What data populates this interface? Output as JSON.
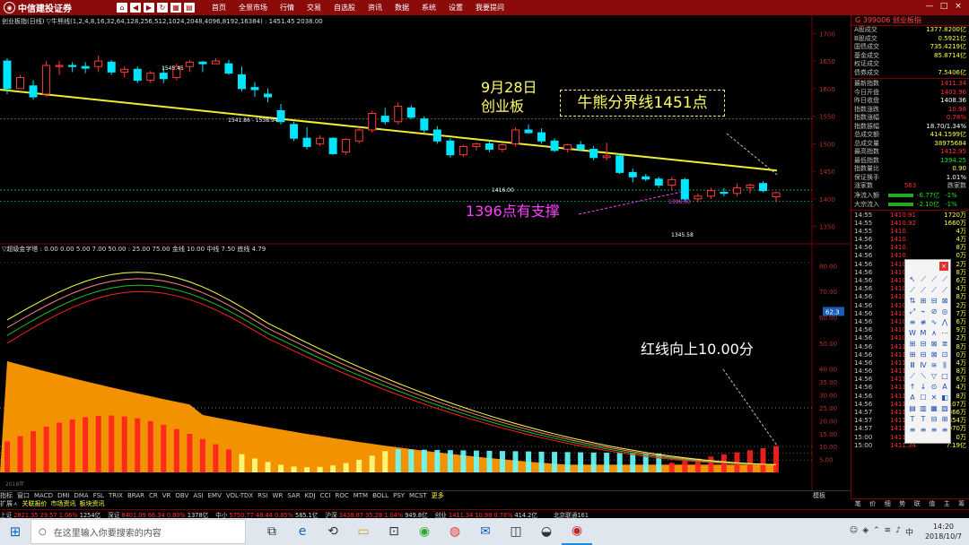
{
  "app": {
    "brand": "中信建投证券",
    "menu": [
      "首页",
      "全景市场",
      "行情",
      "交易",
      "自选股",
      "资讯",
      "数据",
      "系统",
      "设置",
      "我要提问"
    ],
    "window_buttons": [
      "—",
      "□",
      "×"
    ]
  },
  "price_panel": {
    "title": "创业板指(日线)  ▽牛熊线(1,2,4,8,16,32,64,128,256,512,1024,2048,4096,8192,16384)  : 1451.45  2038.00",
    "markers": {
      "high_label": "1545.45",
      "gap_label": "1541.86 - 1538.94",
      "low_label": "1345.58",
      "mid_label": "1416.00",
      "min_label": "1396.00"
    },
    "y_ticks": [
      "1700",
      "1650",
      "1600",
      "1550",
      "1500",
      "1450",
      "1400",
      "1350"
    ]
  },
  "annotations": {
    "date_line1": "9月28日",
    "date_line2": "创业板",
    "bull_bear": "牛熊分界线1451点",
    "support": "1396点有支撑",
    "red_line": "红线向上10.00分"
  },
  "indicator_panel": {
    "title": "▽超级金字塔 : 0.00   0.00   5.00   7.00   50.00 : 25.00   75.00  金线 10.00  中线 7.50  底线 4.79",
    "y_ticks": [
      "80.00",
      "70.00",
      "60.00",
      "50.00",
      "40.00",
      "35.00",
      "30.00",
      "25.00",
      "20.00",
      "15.00",
      "10.00",
      "5.00"
    ],
    "badge": "62.3"
  },
  "right_panel": {
    "code": "G   399006  创业板指",
    "block1": [
      {
        "label": "A股成交",
        "value": "1377.8200亿",
        "color": "#ffff40"
      },
      {
        "label": "B股成交",
        "value": "0.5921亿",
        "color": "#ffff40"
      },
      {
        "label": "国债成交",
        "value": "735.4219亿",
        "color": "#ffff40"
      },
      {
        "label": "基金成交",
        "value": "85.8714亿",
        "color": "#ffff40"
      },
      {
        "label": "权证成交",
        "value": "",
        "color": "#ffff40"
      },
      {
        "label": "债券成交",
        "value": "7.5406亿",
        "color": "#ffff40"
      }
    ],
    "block2": [
      {
        "label": "最新指数",
        "value": "1411.34",
        "color": "#ff3030"
      },
      {
        "label": "今日开盘",
        "value": "1403.96",
        "color": "#ff3030"
      },
      {
        "label": "昨日收盘",
        "value": "1408.36",
        "color": "#ffffff"
      },
      {
        "label": "指数涨跌",
        "value": "10.98",
        "color": "#ff3030"
      },
      {
        "label": "指数涨幅",
        "value": "0.78%",
        "color": "#ff3030"
      },
      {
        "label": "指数振幅",
        "value": "18.70/1.34%",
        "color": "#ffffff"
      },
      {
        "label": "总成交额",
        "value": "414.1599亿",
        "color": "#ffff40"
      },
      {
        "label": "总成交量",
        "value": "38975684",
        "color": "#ffff40"
      },
      {
        "label": "最高指数",
        "value": "1412.95",
        "color": "#ff3030"
      },
      {
        "label": "最低指数",
        "value": "1394.25",
        "color": "#22dd22"
      },
      {
        "label": "指数量比",
        "value": "0.90",
        "color": "#ffff40"
      },
      {
        "label": "保证换手",
        "value": "1.01%",
        "color": "#ffffff"
      }
    ],
    "advance": {
      "label": "涨家数",
      "up": "563",
      "down_label": "跌家数"
    },
    "net_in": [
      {
        "label": "净流入额",
        "value": "-6.77亿",
        "pct": "-1%"
      },
      {
        "label": "大宗流入",
        "value": "-2.10亿",
        "pct": "-1%"
      }
    ],
    "ticks": [
      {
        "t": "14:55",
        "p": "1410.91",
        "v": "1720万"
      },
      {
        "t": "14:55",
        "p": "1410.92",
        "v": "1660万"
      },
      {
        "t": "14:55",
        "p": "1410.",
        "v": "4万"
      },
      {
        "t": "14:56",
        "p": "1410.",
        "v": "4万"
      },
      {
        "t": "14:56",
        "p": "1410.",
        "v": "8万"
      },
      {
        "t": "14:56",
        "p": "1410.",
        "v": "0万"
      },
      {
        "t": "14:56",
        "p": "1410.",
        "v": "2万"
      },
      {
        "t": "14:56",
        "p": "1410.",
        "v": "8万"
      },
      {
        "t": "14:56",
        "p": "1410.",
        "v": "6万"
      },
      {
        "t": "14:56",
        "p": "1410.",
        "v": "4万"
      },
      {
        "t": "14:56",
        "p": "1410.",
        "v": "8万"
      },
      {
        "t": "14:56",
        "p": "1410.",
        "v": "2万"
      },
      {
        "t": "14:56",
        "p": "1410.",
        "v": "7万"
      },
      {
        "t": "14:56",
        "p": "1410.",
        "v": "6万"
      },
      {
        "t": "14:56",
        "p": "1410.",
        "v": "9万"
      },
      {
        "t": "14:56",
        "p": "1410.",
        "v": "2万"
      },
      {
        "t": "14:56",
        "p": "1411.",
        "v": "8万"
      },
      {
        "t": "14:56",
        "p": "1411.",
        "v": "0万"
      },
      {
        "t": "14:56",
        "p": "1411.",
        "v": "4万"
      },
      {
        "t": "14:56",
        "p": "1411.",
        "v": "8万"
      },
      {
        "t": "14:56",
        "p": "1411.",
        "v": "6万"
      },
      {
        "t": "14:56",
        "p": "1411.",
        "v": "4万"
      },
      {
        "t": "14:56",
        "p": "1411.",
        "v": "8万"
      },
      {
        "t": "14:56",
        "p": "1411.82",
        "v": "2107万"
      },
      {
        "t": "14:57",
        "p": "1411.80",
        "v": "1866万"
      },
      {
        "t": "14:57",
        "p": "1411.83",
        "v": "1854万"
      },
      {
        "t": "14:57",
        "p": "1411.83",
        "v": "1970万"
      },
      {
        "t": "15:00",
        "p": "1411.34",
        "v": "0万"
      },
      {
        "t": "15:00",
        "p": "1411.34",
        "v": "7.19亿"
      }
    ],
    "tabs": [
      "笔",
      "价",
      "细",
      "势",
      "联",
      "值",
      "主",
      "筹"
    ]
  },
  "bottom_tabs": [
    "指标",
    "窗口",
    "MACD",
    "DMI",
    "DMA",
    "FSL",
    "TRIX",
    "BRAR",
    "CR",
    "VR",
    "OBV",
    "ASI",
    "EMV",
    "VOL-TDX",
    "RSI",
    "WR",
    "SAR",
    "KDJ",
    "CCI",
    "ROC",
    "MTM",
    "BOLL",
    "PSY",
    "MCST",
    "更多"
  ],
  "bottom_tab_tail": "模板",
  "sub_strip": {
    "label": "扩展ㅅ",
    "items": [
      "关联报价",
      "市场资讯",
      "板块资讯"
    ]
  },
  "index_strip": [
    {
      "name": "上证",
      "price": "2821.35",
      "chg": "29.57",
      "pct": "1.06%",
      "amt": "1254亿"
    },
    {
      "name": "深证",
      "price": "8401.09",
      "chg": "66.34",
      "pct": "0.80%",
      "amt": "1378亿"
    },
    {
      "name": "中小",
      "price": "5750.77",
      "chg": "48.44",
      "pct": "0.85%",
      "amt": "585.1亿"
    },
    {
      "name": "沪深",
      "price": "3438.87",
      "chg": "35.28",
      "pct": "1.04%",
      "amt": "949.8亿"
    },
    {
      "name": "创业",
      "price": "1411.34",
      "chg": "10.98",
      "pct": "0.78%",
      "amt": "414.2亿"
    }
  ],
  "index_strip_tail": "北京联通161",
  "taskbar": {
    "search_placeholder": "在这里输入你要搜索的内容",
    "time": "14:20",
    "date": "2018/10/7"
  },
  "draw_tools": [
    "↖",
    "⟋",
    "⟋",
    "⟋",
    "⟋",
    "⟋",
    "⟋",
    "⟋",
    "⇅",
    "⊞",
    "⊟",
    "⊠",
    "⤢",
    "⌁",
    "⊘",
    "◎",
    "≡",
    "≢",
    "∿",
    "⋀",
    "W",
    "M",
    "∧",
    "⋯",
    "⊞",
    "⊟",
    "⊠",
    "≣",
    "⊞",
    "⊟",
    "⊠",
    "⊡",
    "Ⅲ",
    "Ⅳ",
    "≋",
    "⫼",
    "⟋",
    "⟍",
    "▽",
    "□",
    "↑",
    "↓",
    "⊙",
    "A",
    "A",
    "☐",
    "✕",
    "◧",
    "▤",
    "▥",
    "▦",
    "▧",
    "T",
    "T",
    "⊟",
    "⊞",
    "≡",
    "≡",
    "≡",
    "≡"
  ],
  "chart_data": {
    "type": "candlestick",
    "ylim": [
      1330,
      1720
    ],
    "bull_bear_line": [
      1590,
      1451.45
    ],
    "candles": [
      [
        1650,
        1655,
        1590,
        1600
      ],
      [
        1600,
        1625,
        1600,
        1620
      ],
      [
        1605,
        1615,
        1580,
        1585
      ],
      [
        1590,
        1650,
        1585,
        1642
      ],
      [
        1640,
        1650,
        1625,
        1642
      ],
      [
        1642,
        1648,
        1630,
        1640
      ],
      [
        1640,
        1648,
        1628,
        1637
      ],
      [
        1640,
        1660,
        1630,
        1650
      ],
      [
        1648,
        1652,
        1625,
        1630
      ],
      [
        1630,
        1640,
        1620,
        1635
      ],
      [
        1635,
        1640,
        1610,
        1615
      ],
      [
        1615,
        1632,
        1610,
        1628
      ],
      [
        1628,
        1640,
        1610,
        1618
      ],
      [
        1620,
        1645,
        1615,
        1640
      ],
      [
        1640,
        1652,
        1630,
        1648
      ],
      [
        1648,
        1650,
        1630,
        1645
      ],
      [
        1645,
        1655,
        1645,
        1650
      ],
      [
        1645,
        1652,
        1625,
        1628
      ],
      [
        1625,
        1640,
        1595,
        1600
      ],
      [
        1602,
        1612,
        1585,
        1598
      ],
      [
        1590,
        1600,
        1575,
        1585
      ],
      [
        1560,
        1572,
        1535,
        1540
      ],
      [
        1535,
        1540,
        1505,
        1510
      ],
      [
        1510,
        1530,
        1490,
        1495
      ],
      [
        1500,
        1515,
        1496,
        1510
      ],
      [
        1510,
        1512,
        1480,
        1482
      ],
      [
        1485,
        1510,
        1480,
        1508
      ],
      [
        1505,
        1530,
        1500,
        1525
      ],
      [
        1525,
        1560,
        1520,
        1555
      ],
      [
        1550,
        1565,
        1535,
        1540
      ],
      [
        1540,
        1575,
        1535,
        1568
      ],
      [
        1565,
        1570,
        1545,
        1548
      ],
      [
        1545,
        1550,
        1520,
        1525
      ],
      [
        1525,
        1532,
        1500,
        1505
      ],
      [
        1505,
        1510,
        1475,
        1480
      ],
      [
        1480,
        1498,
        1476,
        1495
      ],
      [
        1495,
        1502,
        1488,
        1500
      ],
      [
        1500,
        1505,
        1485,
        1490
      ],
      [
        1490,
        1502,
        1485,
        1498
      ],
      [
        1500,
        1530,
        1495,
        1525
      ],
      [
        1525,
        1535,
        1518,
        1520
      ],
      [
        1520,
        1528,
        1500,
        1505
      ],
      [
        1505,
        1510,
        1485,
        1488
      ],
      [
        1490,
        1500,
        1484,
        1498
      ],
      [
        1498,
        1505,
        1488,
        1490
      ],
      [
        1490,
        1496,
        1470,
        1475
      ],
      [
        1475,
        1502,
        1470,
        1478
      ],
      [
        1478,
        1482,
        1445,
        1448
      ],
      [
        1448,
        1455,
        1430,
        1440
      ],
      [
        1440,
        1445,
        1432,
        1436
      ],
      [
        1436,
        1440,
        1420,
        1425
      ],
      [
        1425,
        1440,
        1415,
        1435
      ],
      [
        1435,
        1438,
        1395,
        1400
      ],
      [
        1400,
        1410,
        1394,
        1405
      ],
      [
        1405,
        1420,
        1400,
        1415
      ],
      [
        1412,
        1420,
        1405,
        1410
      ],
      [
        1410,
        1428,
        1405,
        1420
      ],
      [
        1420,
        1428,
        1410,
        1425
      ],
      [
        1428,
        1432,
        1412,
        1415
      ],
      [
        1403.96,
        1412.95,
        1394.25,
        1411.34
      ]
    ]
  }
}
